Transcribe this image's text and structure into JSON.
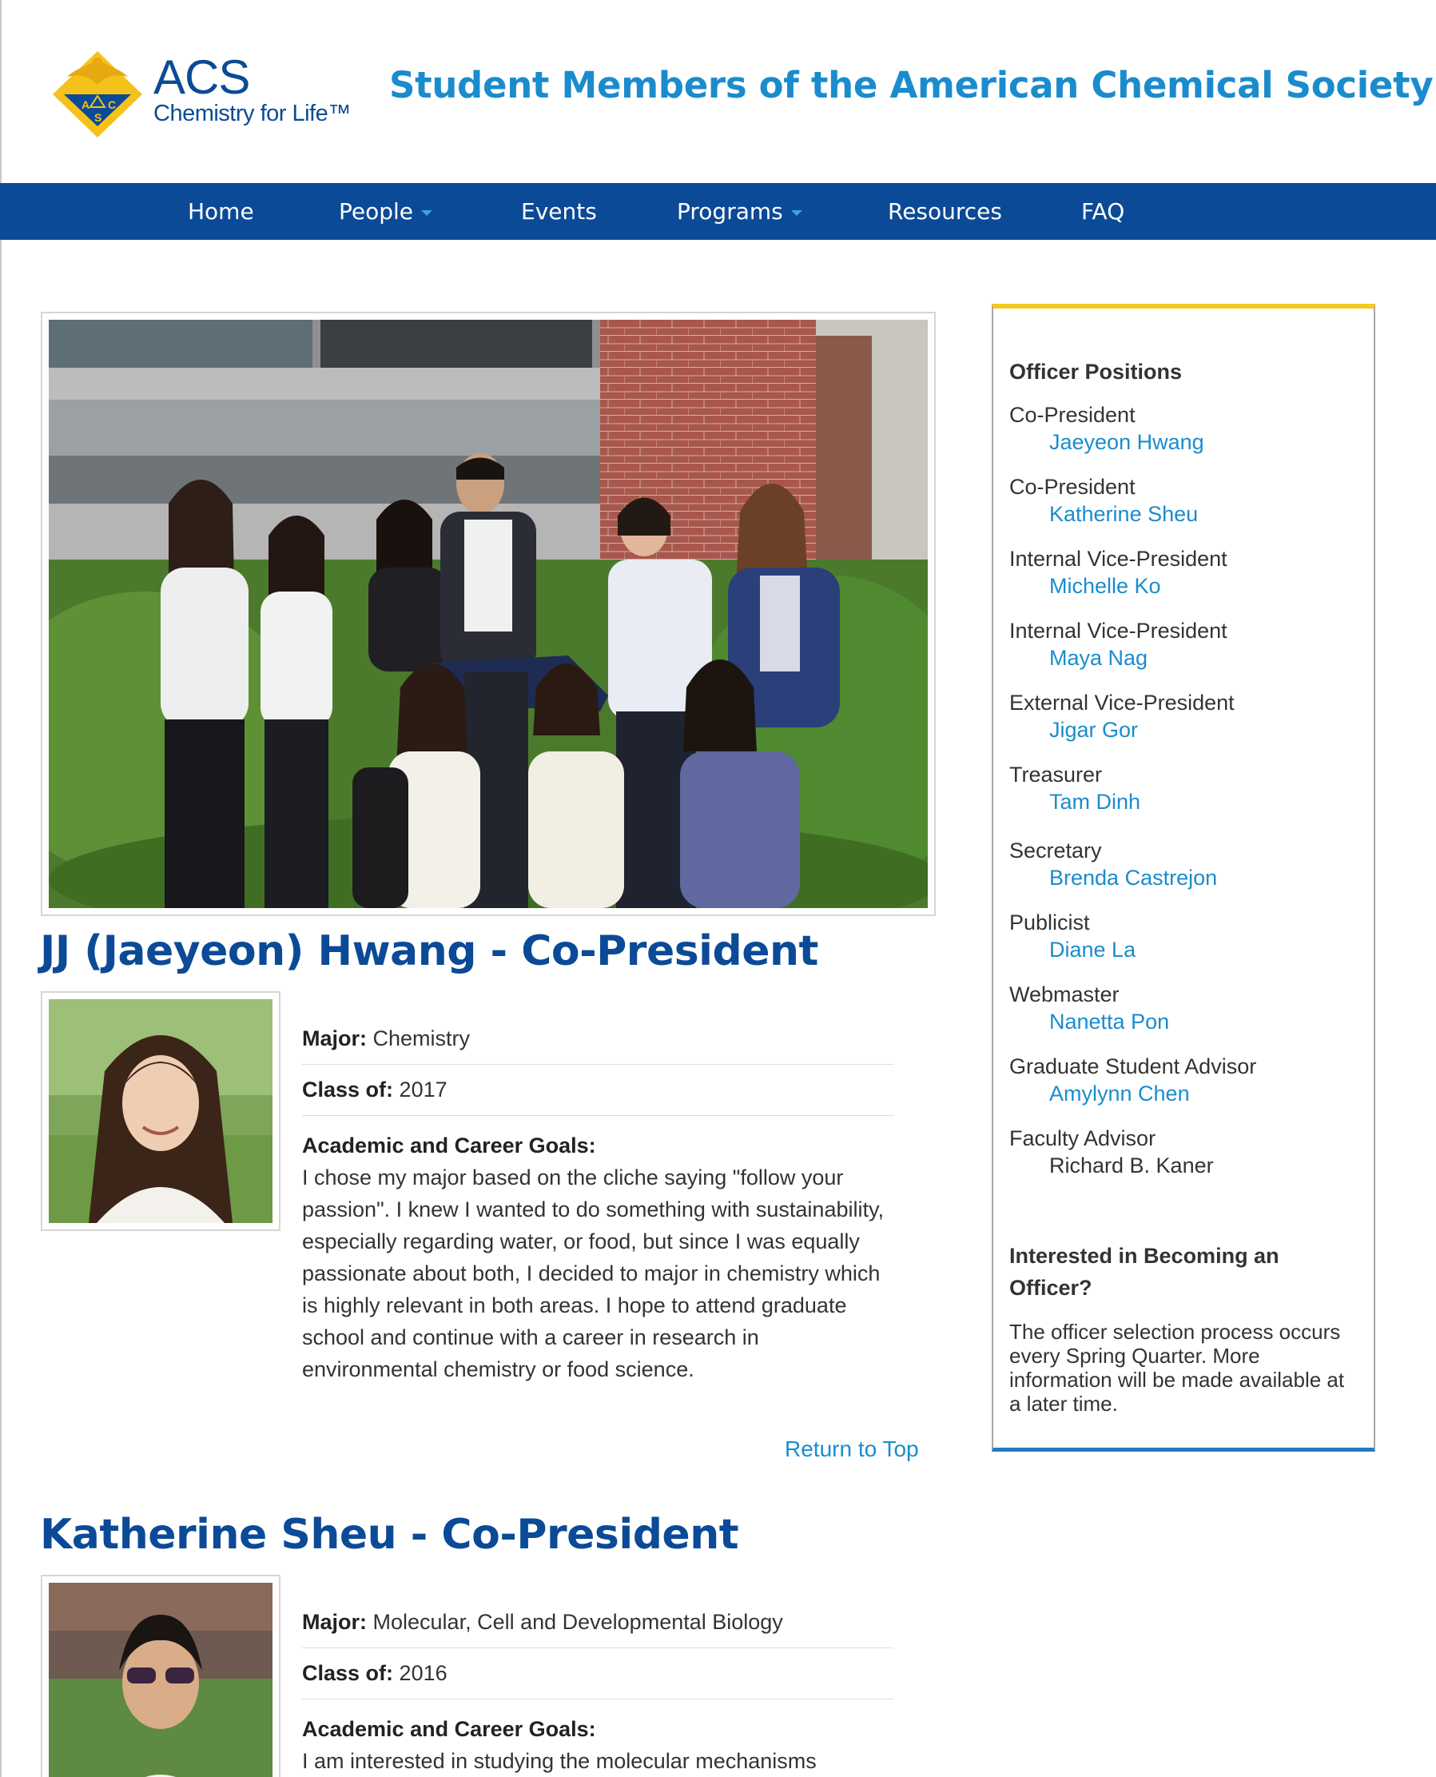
{
  "header": {
    "logo_text": "ACS",
    "logo_tagline": "Chemistry for Life™",
    "site_title": "Student Members of the American Chemical Society"
  },
  "nav": {
    "home": "Home",
    "people": "People",
    "events": "Events",
    "programs": "Programs",
    "resources": "Resources",
    "faq": "FAQ"
  },
  "officers": [
    {
      "heading": "JJ (Jaeyeon) Hwang - Co-President",
      "major_label": "Major:",
      "major": "Chemistry",
      "class_label": "Class of:",
      "class_year": "2017",
      "goals_label": "Academic and Career Goals:",
      "goals": "I chose my major based on the cliche saying \"follow your passion\". I knew I wanted to do something with sustainability, especially regarding water, or food, but since I was equally passionate about both, I decided to major in chemistry which is highly relevant in both areas. I hope to attend graduate school and continue with a career in research in environmental chemistry or food science."
    },
    {
      "heading": "Katherine Sheu - Co-President",
      "major_label": "Major:",
      "major": "Molecular, Cell and Developmental Biology",
      "class_label": "Class of:",
      "class_year": "2016",
      "goals_label": "Academic and Career Goals:",
      "goals": "I am interested in studying the molecular mechanisms"
    }
  ],
  "return_to_top": "Return to Top",
  "sidebar": {
    "title": "Officer Positions",
    "positions": [
      {
        "role": "Co-President",
        "name": "Jaeyeon Hwang"
      },
      {
        "role": "Co-President",
        "name": "Katherine Sheu"
      },
      {
        "role": "Internal Vice-President",
        "name": "Michelle Ko"
      },
      {
        "role": "Internal Vice-President",
        "name": "Maya Nag"
      },
      {
        "role": "External Vice-President",
        "name": "Jigar Gor"
      },
      {
        "role": "Treasurer",
        "name": "Tam Dinh"
      },
      {
        "role": "Secretary",
        "name": "Brenda Castrejon"
      },
      {
        "role": "Publicist",
        "name": "Diane La"
      },
      {
        "role": "Webmaster",
        "name": "Nanetta Pon"
      },
      {
        "role": "Graduate Student Advisor",
        "name": "Amylynn Chen"
      },
      {
        "role": "Faculty Advisor",
        "name": "Richard B. Kaner"
      }
    ],
    "interest_title": "Interested in Becoming an Officer?",
    "interest_text": "The officer selection process occurs every Spring Quarter. More information will be made available at a later time."
  },
  "colors": {
    "nav_bg": "#0b4a97",
    "heading_blue": "#0b4a97",
    "link_blue": "#1a8ccd",
    "sidebar_top": "#f5c823",
    "sidebar_bottom": "#2479c4"
  }
}
